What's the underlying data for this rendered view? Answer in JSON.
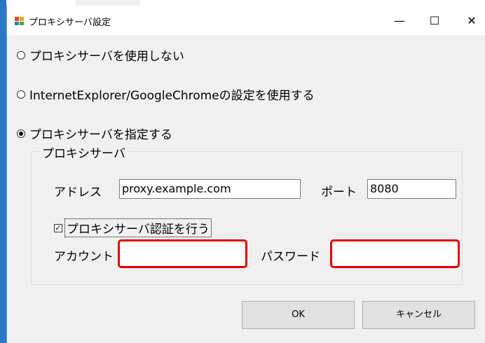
{
  "window": {
    "title": "プロキシサーバ設定"
  },
  "titlebar_buttons": {
    "minimize": "—",
    "maximize": "☐",
    "close": "✕"
  },
  "options": {
    "no_proxy": "プロキシサーバを使用しない",
    "use_browser": "InternetExplorer/GoogleChromeの設定を使用する",
    "specify": "プロキシサーバを指定する",
    "selected": "specify"
  },
  "proxy_group": {
    "title": "プロキシサーバ",
    "address_label": "アドレス",
    "address_value": "proxy.example.com",
    "port_label": "ポート",
    "port_value": "8080",
    "auth_checkbox_label": "プロキシサーバ認証を行う",
    "auth_checked": true,
    "account_label": "アカウント",
    "account_value": "",
    "password_label": "パスワード",
    "password_value": ""
  },
  "buttons": {
    "ok": "OK",
    "cancel": "キャンセル"
  },
  "colors": {
    "highlight": "#e00000",
    "window_bg": "#f0f0f0"
  }
}
